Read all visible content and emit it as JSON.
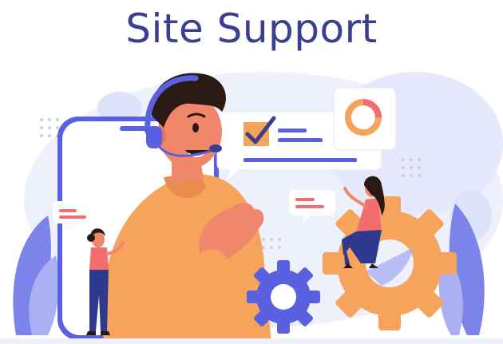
{
  "title": "Site Support",
  "colors": {
    "title": "#3a3f8f",
    "primary": "#5961e0",
    "accent": "#f6a35c",
    "skin": "#f0866a",
    "dark_hair": "#2b1a14",
    "bg_soft": "#eef0fb",
    "navy": "#2f3a8f",
    "red_accent": "#f26d6d"
  },
  "icons": [
    "headset-icon",
    "checkbox-icon",
    "donut-chart-icon",
    "gear-icon"
  ]
}
